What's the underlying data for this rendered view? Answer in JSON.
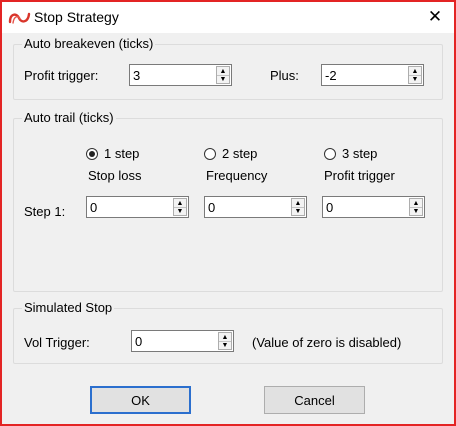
{
  "window": {
    "title": "Stop Strategy",
    "close_glyph": "✕",
    "icon": "app-logo-icon",
    "border_color": "#e32424"
  },
  "breakeven": {
    "legend": "Auto breakeven (ticks)",
    "profit_trigger_label": "Profit trigger:",
    "profit_trigger_value": "3",
    "plus_label": "Plus:",
    "plus_value": "-2"
  },
  "trail": {
    "legend": "Auto trail (ticks)",
    "options": [
      {
        "label": "1 step",
        "selected": true
      },
      {
        "label": "2 step",
        "selected": false
      },
      {
        "label": "3 step",
        "selected": false
      }
    ],
    "columns": [
      "Stop loss",
      "Frequency",
      "Profit trigger"
    ],
    "step_label": "Step 1:",
    "step_values": [
      "0",
      "0",
      "0"
    ]
  },
  "simulated": {
    "legend": "Simulated Stop",
    "vol_trigger_label": "Vol Trigger:",
    "vol_trigger_value": "0",
    "note": "(Value of zero is disabled)"
  },
  "buttons": {
    "ok": "OK",
    "cancel": "Cancel",
    "default_color": "#2b6fce"
  },
  "icons": {
    "spin_up": "▲",
    "spin_down": "▼"
  }
}
